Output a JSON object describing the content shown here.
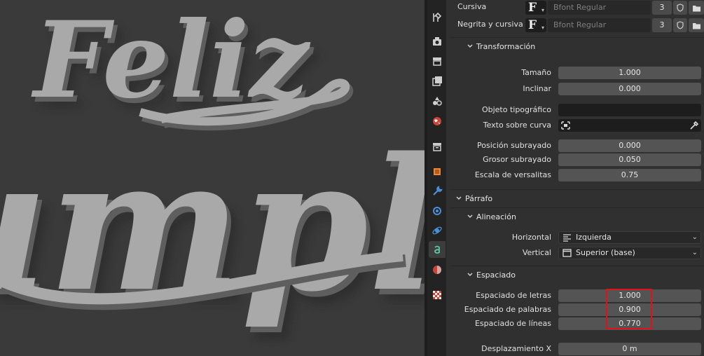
{
  "viewport": {
    "text_lines": [
      "Feliz",
      "umple"
    ]
  },
  "tabs": [
    {
      "name": "tool-icon"
    },
    {
      "name": "render-icon"
    },
    {
      "name": "output-icon"
    },
    {
      "name": "view-layer-icon"
    },
    {
      "name": "scene-icon"
    },
    {
      "name": "world-icon"
    },
    {
      "name": "collection-icon"
    },
    {
      "name": "object-icon"
    },
    {
      "name": "modifier-icon"
    },
    {
      "name": "particles-icon"
    },
    {
      "name": "physics-icon"
    },
    {
      "name": "text-data-icon"
    },
    {
      "name": "material-icon"
    },
    {
      "name": "texture-icon"
    }
  ],
  "fonts": {
    "italic": {
      "label": "Cursiva",
      "font": "Bfont Regular",
      "users": "3"
    },
    "bold_italic": {
      "label": "Negrita y cursiva",
      "font": "Bfont Regular",
      "users": "3"
    }
  },
  "transform": {
    "title": "Transformación",
    "size_label": "Tamaño",
    "size_value": "1.000",
    "shear_label": "Inclinar",
    "shear_value": "0.000",
    "object_font_label": "Objeto tipográfico",
    "text_on_curve_label": "Texto sobre curva",
    "underline_pos_label": "Posición subrayado",
    "underline_pos_value": "0.000",
    "underline_thick_label": "Grosor subrayado",
    "underline_thick_value": "0.050",
    "small_caps_label": "Escala de versalitas",
    "small_caps_value": "0.75"
  },
  "paragraph": {
    "title": "Párrafo",
    "alignment": {
      "title": "Alineación",
      "horizontal_label": "Horizontal",
      "horizontal_value": "Izquierda",
      "vertical_label": "Vertical",
      "vertical_value": "Superior (base)"
    },
    "spacing": {
      "title": "Espaciado",
      "char_label": "Espaciado de letras",
      "char_value": "1.000",
      "word_label": "Espaciado de palabras",
      "word_value": "0.900",
      "line_label": "Espaciado de líneas",
      "line_value": "0.770",
      "offset_x_label": "Desplazamiento X",
      "offset_x_value": "0 m"
    }
  },
  "colors": {
    "highlight": "#e0131a",
    "active_tab_icon": "#5fc6a8"
  }
}
